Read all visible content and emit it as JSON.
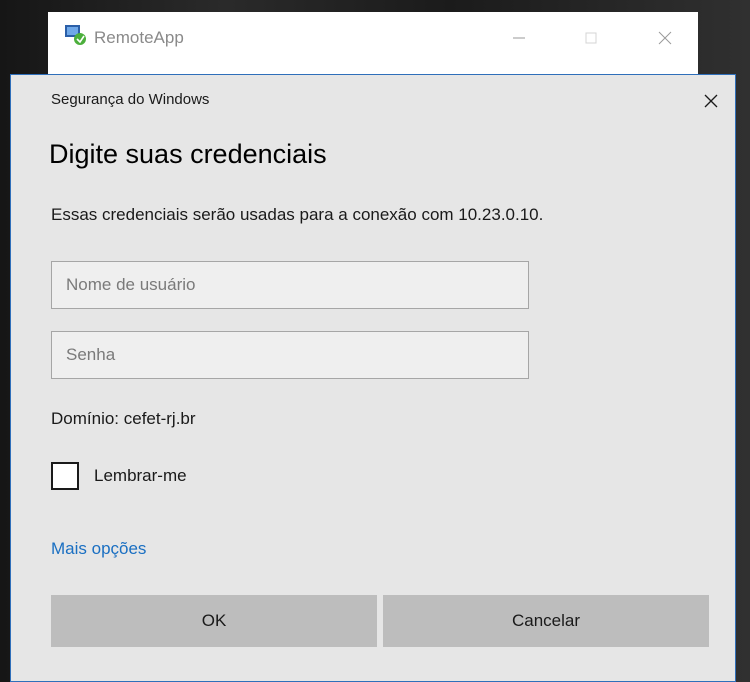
{
  "remote_window": {
    "title": "RemoteApp",
    "icon": "remoteapp-icon",
    "controls": [
      "minimize-icon",
      "maximize-icon",
      "close-icon"
    ]
  },
  "dialog": {
    "caption": "Segurança do Windows",
    "heading": "Digite suas credenciais",
    "description": "Essas credenciais serão usadas para a conexão com 10.23.0.10.",
    "username": {
      "value": "",
      "placeholder": "Nome de usuário"
    },
    "password": {
      "value": "",
      "placeholder": "Senha"
    },
    "domain": "Domínio: cefet-rj.br",
    "remember": {
      "label": "Lembrar-me",
      "checked": false
    },
    "more_options": "Mais opções",
    "ok_label": "OK",
    "cancel_label": "Cancelar"
  },
  "colors": {
    "dialog_bg": "#e6e6e6",
    "link": "#1a6fc2",
    "button_bg": "#bdbdbd",
    "field_border": "#a6a6a6"
  }
}
